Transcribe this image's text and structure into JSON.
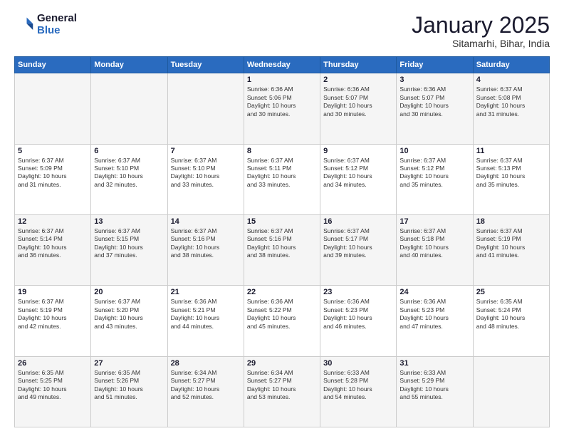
{
  "header": {
    "logo_line1": "General",
    "logo_line2": "Blue",
    "month": "January 2025",
    "location": "Sitamarhi, Bihar, India"
  },
  "weekdays": [
    "Sunday",
    "Monday",
    "Tuesday",
    "Wednesday",
    "Thursday",
    "Friday",
    "Saturday"
  ],
  "weeks": [
    [
      {
        "day": "",
        "text": ""
      },
      {
        "day": "",
        "text": ""
      },
      {
        "day": "",
        "text": ""
      },
      {
        "day": "1",
        "text": "Sunrise: 6:36 AM\nSunset: 5:06 PM\nDaylight: 10 hours\nand 30 minutes."
      },
      {
        "day": "2",
        "text": "Sunrise: 6:36 AM\nSunset: 5:07 PM\nDaylight: 10 hours\nand 30 minutes."
      },
      {
        "day": "3",
        "text": "Sunrise: 6:36 AM\nSunset: 5:07 PM\nDaylight: 10 hours\nand 30 minutes."
      },
      {
        "day": "4",
        "text": "Sunrise: 6:37 AM\nSunset: 5:08 PM\nDaylight: 10 hours\nand 31 minutes."
      }
    ],
    [
      {
        "day": "5",
        "text": "Sunrise: 6:37 AM\nSunset: 5:09 PM\nDaylight: 10 hours\nand 31 minutes."
      },
      {
        "day": "6",
        "text": "Sunrise: 6:37 AM\nSunset: 5:10 PM\nDaylight: 10 hours\nand 32 minutes."
      },
      {
        "day": "7",
        "text": "Sunrise: 6:37 AM\nSunset: 5:10 PM\nDaylight: 10 hours\nand 33 minutes."
      },
      {
        "day": "8",
        "text": "Sunrise: 6:37 AM\nSunset: 5:11 PM\nDaylight: 10 hours\nand 33 minutes."
      },
      {
        "day": "9",
        "text": "Sunrise: 6:37 AM\nSunset: 5:12 PM\nDaylight: 10 hours\nand 34 minutes."
      },
      {
        "day": "10",
        "text": "Sunrise: 6:37 AM\nSunset: 5:12 PM\nDaylight: 10 hours\nand 35 minutes."
      },
      {
        "day": "11",
        "text": "Sunrise: 6:37 AM\nSunset: 5:13 PM\nDaylight: 10 hours\nand 35 minutes."
      }
    ],
    [
      {
        "day": "12",
        "text": "Sunrise: 6:37 AM\nSunset: 5:14 PM\nDaylight: 10 hours\nand 36 minutes."
      },
      {
        "day": "13",
        "text": "Sunrise: 6:37 AM\nSunset: 5:15 PM\nDaylight: 10 hours\nand 37 minutes."
      },
      {
        "day": "14",
        "text": "Sunrise: 6:37 AM\nSunset: 5:16 PM\nDaylight: 10 hours\nand 38 minutes."
      },
      {
        "day": "15",
        "text": "Sunrise: 6:37 AM\nSunset: 5:16 PM\nDaylight: 10 hours\nand 38 minutes."
      },
      {
        "day": "16",
        "text": "Sunrise: 6:37 AM\nSunset: 5:17 PM\nDaylight: 10 hours\nand 39 minutes."
      },
      {
        "day": "17",
        "text": "Sunrise: 6:37 AM\nSunset: 5:18 PM\nDaylight: 10 hours\nand 40 minutes."
      },
      {
        "day": "18",
        "text": "Sunrise: 6:37 AM\nSunset: 5:19 PM\nDaylight: 10 hours\nand 41 minutes."
      }
    ],
    [
      {
        "day": "19",
        "text": "Sunrise: 6:37 AM\nSunset: 5:19 PM\nDaylight: 10 hours\nand 42 minutes."
      },
      {
        "day": "20",
        "text": "Sunrise: 6:37 AM\nSunset: 5:20 PM\nDaylight: 10 hours\nand 43 minutes."
      },
      {
        "day": "21",
        "text": "Sunrise: 6:36 AM\nSunset: 5:21 PM\nDaylight: 10 hours\nand 44 minutes."
      },
      {
        "day": "22",
        "text": "Sunrise: 6:36 AM\nSunset: 5:22 PM\nDaylight: 10 hours\nand 45 minutes."
      },
      {
        "day": "23",
        "text": "Sunrise: 6:36 AM\nSunset: 5:23 PM\nDaylight: 10 hours\nand 46 minutes."
      },
      {
        "day": "24",
        "text": "Sunrise: 6:36 AM\nSunset: 5:23 PM\nDaylight: 10 hours\nand 47 minutes."
      },
      {
        "day": "25",
        "text": "Sunrise: 6:35 AM\nSunset: 5:24 PM\nDaylight: 10 hours\nand 48 minutes."
      }
    ],
    [
      {
        "day": "26",
        "text": "Sunrise: 6:35 AM\nSunset: 5:25 PM\nDaylight: 10 hours\nand 49 minutes."
      },
      {
        "day": "27",
        "text": "Sunrise: 6:35 AM\nSunset: 5:26 PM\nDaylight: 10 hours\nand 51 minutes."
      },
      {
        "day": "28",
        "text": "Sunrise: 6:34 AM\nSunset: 5:27 PM\nDaylight: 10 hours\nand 52 minutes."
      },
      {
        "day": "29",
        "text": "Sunrise: 6:34 AM\nSunset: 5:27 PM\nDaylight: 10 hours\nand 53 minutes."
      },
      {
        "day": "30",
        "text": "Sunrise: 6:33 AM\nSunset: 5:28 PM\nDaylight: 10 hours\nand 54 minutes."
      },
      {
        "day": "31",
        "text": "Sunrise: 6:33 AM\nSunset: 5:29 PM\nDaylight: 10 hours\nand 55 minutes."
      },
      {
        "day": "",
        "text": ""
      }
    ]
  ]
}
